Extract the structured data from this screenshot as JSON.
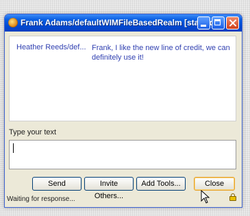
{
  "window": {
    "title": "Frank Adams/defaultWIMFileBasedRealm [started:...",
    "icon": "chat-app-icon",
    "controls": [
      "minimize-icon",
      "maximize-icon",
      "close-icon"
    ]
  },
  "messages": [
    {
      "sender": "Heather Reeds/def...",
      "text": "Frank, I like the new line of credit, we can definitely use it!"
    }
  ],
  "compose": {
    "label": "Type your text",
    "value": ""
  },
  "buttons": {
    "send": "Send",
    "invite": "Invite Others...",
    "tools": "Add Tools...",
    "close": "Close"
  },
  "status": {
    "text": "Waiting for response...",
    "icon": "lock-icon"
  },
  "colors": {
    "titlebar": "#0a5fe2",
    "message_text": "#2f3fb0",
    "window_bg": "#ece9d8"
  }
}
